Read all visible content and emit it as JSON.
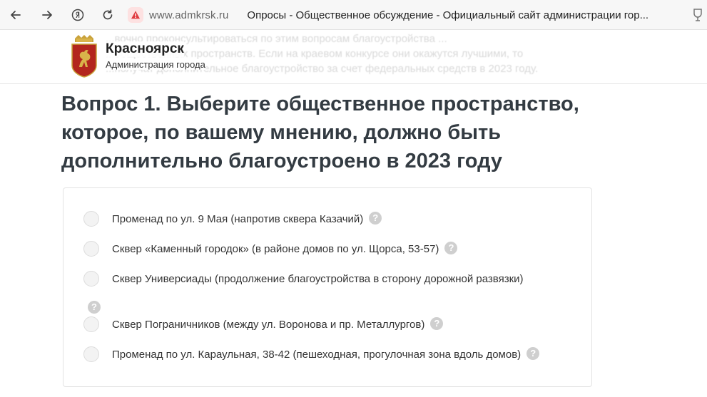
{
  "browser": {
    "url": "www.admkrsk.ru",
    "tab_title": "Опросы - Общественное обсуждение - Официальный сайт администрации гор..."
  },
  "header": {
    "brand_name": "Красноярск",
    "brand_sub": "Администрация города"
  },
  "background_text": [
    "...вочно проконсультироваться по этим вопросам благоустройства ...",
    "...общественных пространств. Если на краевом конкурсе они окажутся лучшими, то",
    "...получат дополнительное благоустройство за счет федеральных средств в 2023 году."
  ],
  "question": {
    "title_lines": [
      "Вопрос 1. Выберите общественное пространство,",
      "которое, по вашему мнению, должно быть",
      "дополнительно благоустроено в 2023 году"
    ],
    "options": [
      {
        "label": "Променад по ул. 9 Мая (напротив сквера Казачий)"
      },
      {
        "label": "Сквер «Каменный городок» (в районе домов по ул. Щорса, 53-57)"
      },
      {
        "label": "Сквер Универсиады (продолжение благоустройства в сторону дорожной развязки)"
      },
      {
        "label": "Сквер Пограничников (между ул. Воронова и пр. Металлургов)"
      },
      {
        "label": "Променад по ул. Караульная, 38-42 (пешеходная, прогулочная зона вдоль домов)"
      }
    ],
    "help_glyph": "?"
  },
  "icons": {
    "back": "arrow-left-icon",
    "forward": "arrow-right-icon",
    "yandex": "yandex-logo-icon",
    "reload": "reload-icon",
    "warning": "warning-icon",
    "extension": "extension-icon"
  }
}
